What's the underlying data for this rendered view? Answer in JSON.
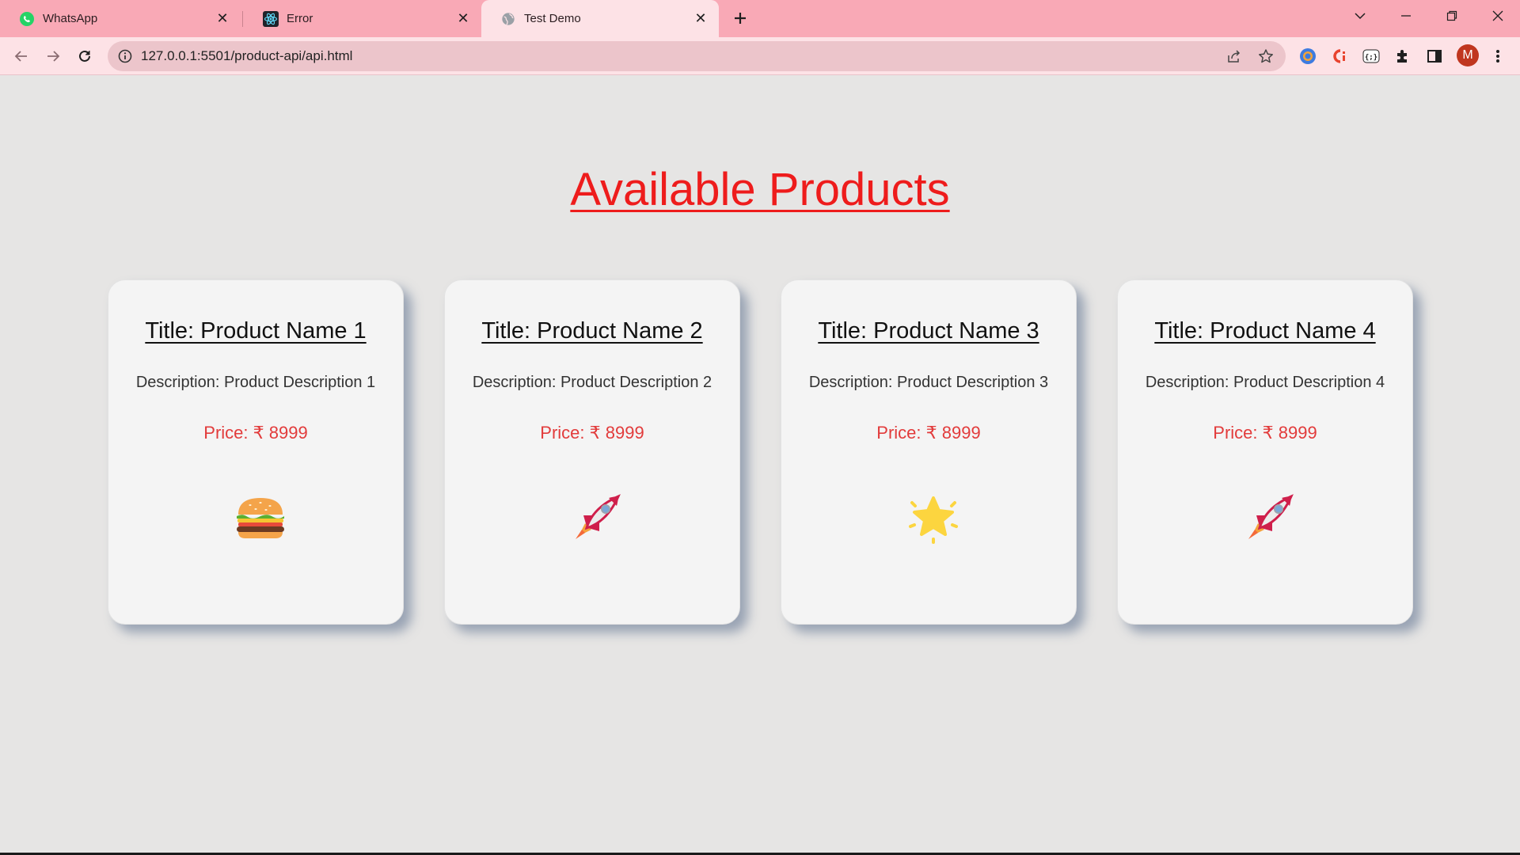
{
  "browser": {
    "tabs": [
      {
        "title": "WhatsApp",
        "icon": "whatsapp-icon",
        "active": false
      },
      {
        "title": "Error",
        "icon": "react-icon",
        "active": false
      },
      {
        "title": "Test Demo",
        "icon": "globe-icon",
        "active": true
      }
    ],
    "url": "127.0.0.1:5501/product-api/api.html",
    "profile_initial": "M"
  },
  "page": {
    "heading": "Available Products",
    "heading_color": "#ee1c1c",
    "products": [
      {
        "title": "Title: Product Name 1",
        "description": "Description: Product Description 1",
        "price": "Price: ₹ 8999",
        "icon": "burger-icon"
      },
      {
        "title": "Title: Product Name 2",
        "description": "Description: Product Description 2",
        "price": "Price: ₹ 8999",
        "icon": "rocket-icon"
      },
      {
        "title": "Title: Product Name 3",
        "description": "Description: Product Description 3",
        "price": "Price: ₹ 8999",
        "icon": "star-icon"
      },
      {
        "title": "Title: Product Name 4",
        "description": "Description: Product Description 4",
        "price": "Price: ₹ 8999",
        "icon": "rocket-icon"
      }
    ]
  }
}
